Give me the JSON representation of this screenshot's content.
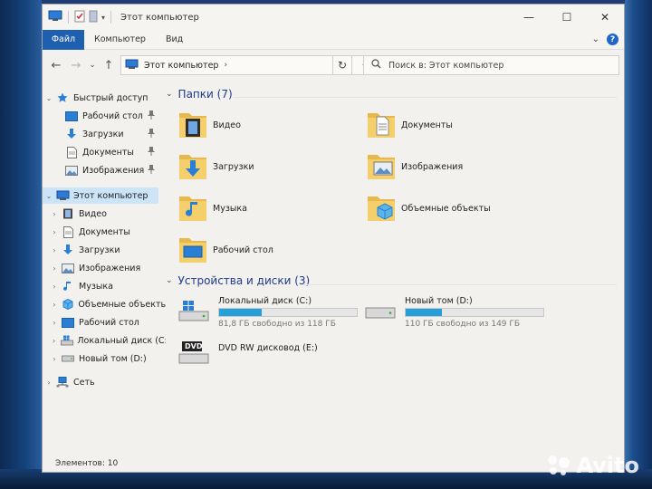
{
  "window": {
    "title": "Этот компьютер",
    "controls": {
      "minimize": "—",
      "maximize": "☐",
      "close": "✕"
    }
  },
  "ribbon": {
    "tabs": [
      {
        "label": "Файл",
        "active": true
      },
      {
        "label": "Компьютер"
      },
      {
        "label": "Вид"
      }
    ],
    "expand": "⌄",
    "help": "?"
  },
  "nav": {
    "back": "←",
    "forward": "→",
    "recent": "⌄",
    "up": "↑",
    "address": "Этот компьютер",
    "address_arrow": "›",
    "dropdown": "⌄",
    "refresh": "↻",
    "search_placeholder": "Поиск в: Этот компьютер"
  },
  "sidebar": {
    "items": [
      {
        "label": "Быстрый доступ",
        "icon": "star-icon",
        "level": 0,
        "chevron": "⌄"
      },
      {
        "label": "Рабочий стол",
        "icon": "desktop-icon",
        "level": 1,
        "pinned": true
      },
      {
        "label": "Загрузки",
        "icon": "download-icon",
        "level": 1,
        "pinned": true
      },
      {
        "label": "Документы",
        "icon": "documents-icon",
        "level": 1,
        "pinned": true
      },
      {
        "label": "Изображения",
        "icon": "pictures-icon",
        "level": 1,
        "pinned": true
      },
      {
        "label": "Этот компьютер",
        "icon": "computer-icon",
        "level": 0,
        "chevron": "⌄",
        "selected": true
      },
      {
        "label": "Видео",
        "icon": "video-icon",
        "level": 1,
        "chevron": "›"
      },
      {
        "label": "Документы",
        "icon": "documents-icon",
        "level": 1,
        "chevron": "›"
      },
      {
        "label": "Загрузки",
        "icon": "download-icon",
        "level": 1,
        "chevron": "›"
      },
      {
        "label": "Изображения",
        "icon": "pictures-icon",
        "level": 1,
        "chevron": "›"
      },
      {
        "label": "Музыка",
        "icon": "music-icon",
        "level": 1,
        "chevron": "›"
      },
      {
        "label": "Объемные объекты",
        "icon": "3d-objects-icon",
        "level": 1,
        "chevron": "›"
      },
      {
        "label": "Рабочий стол",
        "icon": "desktop-icon",
        "level": 1,
        "chevron": "›"
      },
      {
        "label": "Локальный диск (C:)",
        "icon": "windows-drive-icon",
        "level": 1,
        "chevron": "›"
      },
      {
        "label": "Новый том (D:)",
        "icon": "drive-icon",
        "level": 1,
        "chevron": "›"
      },
      {
        "label": "Сеть",
        "icon": "network-icon",
        "level": 0,
        "chevron": "›"
      }
    ],
    "pin_glyph": "📌"
  },
  "content": {
    "folders_header": "Папки (7)",
    "folders": [
      {
        "label": "Видео",
        "icon": "video-folder-icon"
      },
      {
        "label": "Документы",
        "icon": "documents-folder-icon"
      },
      {
        "label": "Загрузки",
        "icon": "downloads-folder-icon"
      },
      {
        "label": "Изображения",
        "icon": "pictures-folder-icon"
      },
      {
        "label": "Музыка",
        "icon": "music-folder-icon"
      },
      {
        "label": "Объемные объекты",
        "icon": "3d-objects-folder-icon"
      },
      {
        "label": "Рабочий стол",
        "icon": "desktop-folder-icon"
      }
    ],
    "devices_header": "Устройства и диски (3)",
    "drives": [
      {
        "name": "Локальный диск (C:)",
        "free_text": "81,8 ГБ свободно из 118 ГБ",
        "used_fraction": 0.31,
        "icon": "windows-drive-icon"
      },
      {
        "name": "Новый том (D:)",
        "free_text": "110 ГБ свободно из 149 ГБ",
        "used_fraction": 0.26,
        "icon": "drive-icon"
      },
      {
        "name": "DVD RW дисковод (E:)",
        "icon": "dvd-drive-icon",
        "badge": "DVD"
      }
    ]
  },
  "status": {
    "text": "Элементов: 10"
  },
  "watermark": {
    "text": "Avito"
  }
}
